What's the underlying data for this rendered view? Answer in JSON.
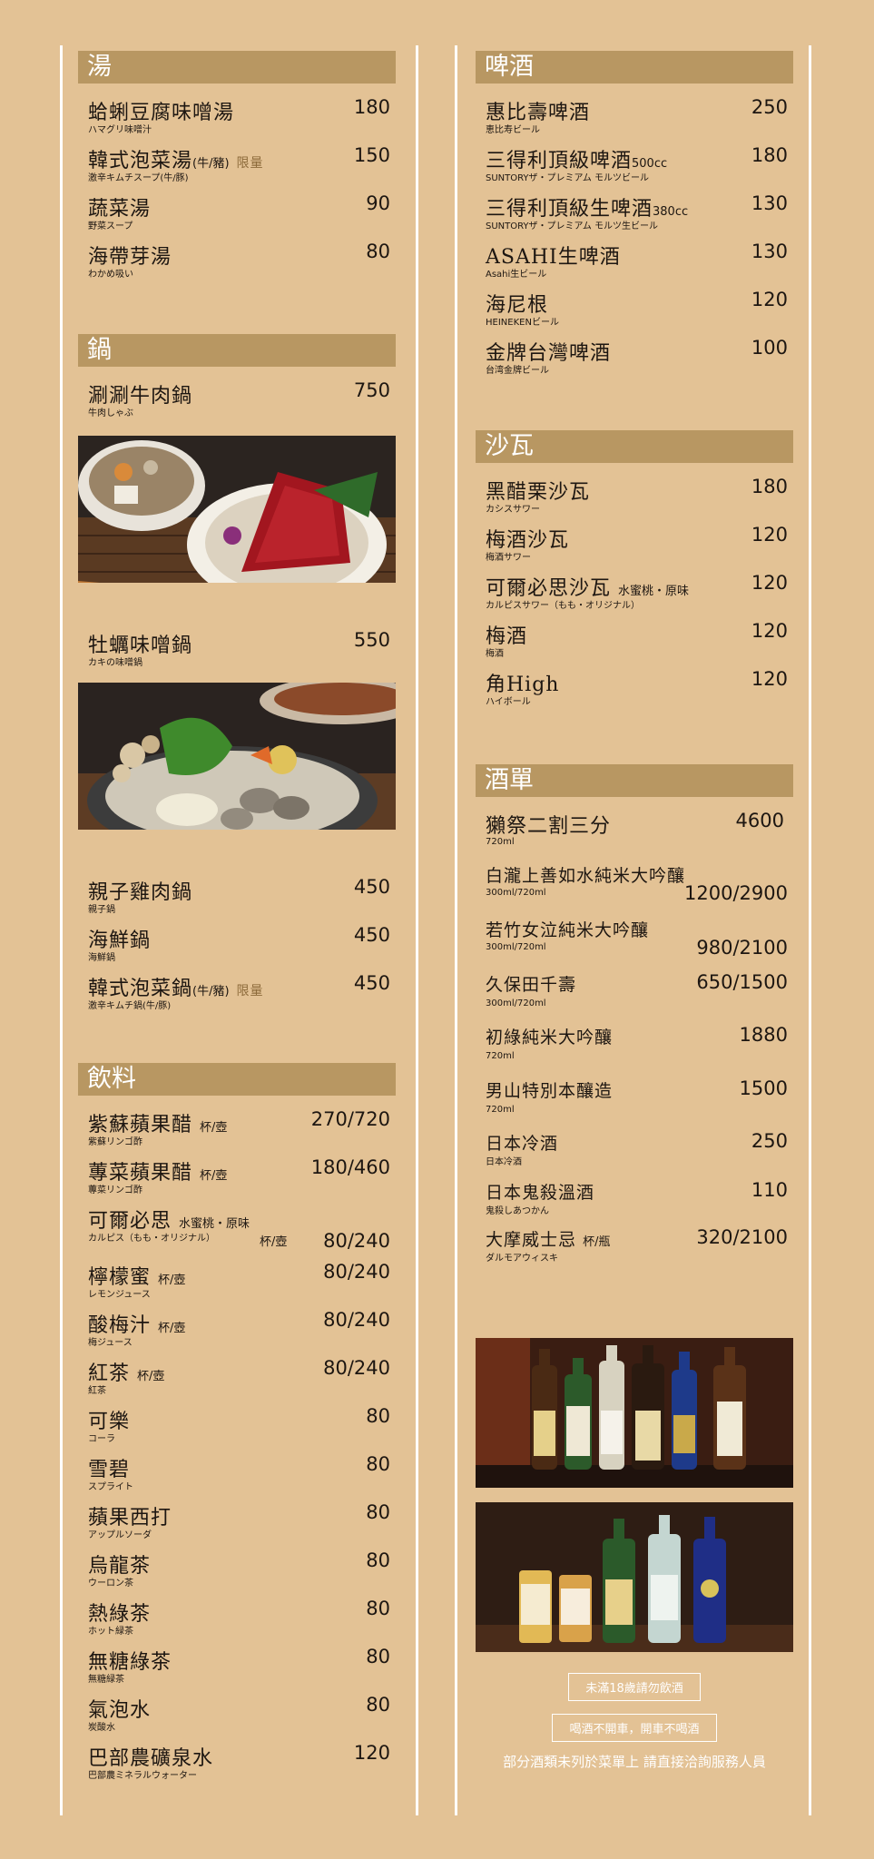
{
  "soup": {
    "title": "湯",
    "items": [
      {
        "name": "蛤蜊豆腐味噌湯",
        "sub": "ハマグリ味噌汁",
        "price": "180"
      },
      {
        "name": "韓式泡菜湯",
        "tag": "(牛/豬)",
        "note": "限量",
        "sub": "激辛キムチスープ(牛/豚)",
        "price": "150"
      },
      {
        "name": "蔬菜湯",
        "sub": "野菜スープ",
        "price": "90"
      },
      {
        "name": "海帶芽湯",
        "sub": "わかめ吸い",
        "price": "80"
      }
    ]
  },
  "pot": {
    "title": "鍋",
    "items": [
      {
        "name": "涮涮牛肉鍋",
        "sub": "牛肉しゃぶ",
        "price": "750"
      },
      {
        "name": "牡蠣味噌鍋",
        "sub": "カキの味噌鍋",
        "price": "550"
      },
      {
        "name": "親子雞肉鍋",
        "sub": "親子鍋",
        "price": "450"
      },
      {
        "name": "海鮮鍋",
        "sub": "海鮮鍋",
        "price": "450"
      },
      {
        "name": "韓式泡菜鍋",
        "tag": "(牛/豬)",
        "note": "限量",
        "sub": "激辛キムチ鍋(牛/豚)",
        "price": "450"
      }
    ]
  },
  "drinks": {
    "title": "飲料",
    "items": [
      {
        "name": "紫蘇蘋果醋",
        "tag": "杯/壺",
        "sub": "紫蘇リンゴ酢",
        "price": "270/720"
      },
      {
        "name": "蓴菜蘋果醋",
        "tag": "杯/壺",
        "sub": "蓴菜リンゴ酢",
        "price": "180/460"
      },
      {
        "name": "可爾必思",
        "tag": "水蜜桃・原味",
        "sub": "カルピス（もも・オリジナル）",
        "unit2": "杯/壺",
        "price": "80/240"
      },
      {
        "name": "檸檬蜜",
        "tag": "杯/壺",
        "sub": "レモンジュース",
        "price": "80/240"
      },
      {
        "name": "酸梅汁",
        "tag": "杯/壺",
        "sub": "梅ジュース",
        "price": "80/240"
      },
      {
        "name": "紅茶",
        "tag": "杯/壺",
        "sub": "紅茶",
        "price": "80/240"
      },
      {
        "name": "可樂",
        "sub": "コーラ",
        "price": "80"
      },
      {
        "name": "雪碧",
        "sub": "スプライト",
        "price": "80"
      },
      {
        "name": "蘋果西打",
        "sub": "アップルソーダ",
        "price": "80"
      },
      {
        "name": "烏龍茶",
        "sub": "ウーロン茶",
        "price": "80"
      },
      {
        "name": "熱綠茶",
        "sub": "ホット緑茶",
        "price": "80"
      },
      {
        "name": "無糖綠茶",
        "sub": "無糖緑茶",
        "price": "80"
      },
      {
        "name": "氣泡水",
        "sub": "炭酸水",
        "price": "80"
      },
      {
        "name": "巴部農礦泉水",
        "sub": "巴部農ミネラルウォーター",
        "price": "120"
      }
    ]
  },
  "beer": {
    "title": "啤酒",
    "items": [
      {
        "name": "惠比壽啤酒",
        "sub": "恵比寿ビール",
        "price": "250"
      },
      {
        "name": "三得利頂級啤酒",
        "tag": "500cc",
        "sub": "SUNTORYザ・プレミアム モルツビール",
        "price": "180"
      },
      {
        "name": "三得利頂級生啤酒",
        "tag": "380cc",
        "sub": "SUNTORYザ・プレミアム モルツ生ビール",
        "price": "130"
      },
      {
        "name": "ASAHI生啤酒",
        "sub": "Asahi生ビール",
        "price": "130"
      },
      {
        "name": "海尼根",
        "sub": "HEINEKENビール",
        "price": "120"
      },
      {
        "name": "金牌台灣啤酒",
        "sub": "台湾金牌ビール",
        "price": "100"
      }
    ]
  },
  "sour": {
    "title": "沙瓦",
    "items": [
      {
        "name": "黑醋栗沙瓦",
        "sub": "カシスサワー",
        "price": "180"
      },
      {
        "name": "梅酒沙瓦",
        "sub": "梅酒サワー",
        "price": "120"
      },
      {
        "name": "可爾必思沙瓦",
        "tag": "水蜜桃・原味",
        "sub": "カルピスサワー（もも・オリジナル）",
        "price": "120"
      },
      {
        "name": "梅酒",
        "sub": "梅酒",
        "price": "120"
      },
      {
        "name": "角High",
        "sub": "ハイボール",
        "price": "120"
      }
    ]
  },
  "sake": {
    "title": "酒單",
    "items": [
      {
        "name": "獺祭二割三分",
        "sub": "720ml",
        "price": "4600"
      },
      {
        "name": "白瀧上善如水純米大吟釀",
        "sub": "300ml/720ml",
        "price": "1200/2900"
      },
      {
        "name": "若竹女泣純米大吟釀",
        "sub": "300ml/720ml",
        "price": "980/2100"
      },
      {
        "name": "久保田千壽",
        "sub": "300ml/720ml",
        "price": "650/1500"
      },
      {
        "name": "初綠純米大吟釀",
        "sub": "720ml",
        "price": "1880"
      },
      {
        "name": "男山特別本釀造",
        "sub": "720ml",
        "price": "1500"
      },
      {
        "name": "日本冷酒",
        "sub": "日本冷酒",
        "price": "250"
      },
      {
        "name": "日本鬼殺溫酒",
        "sub": "鬼殺しあつかん",
        "price": "110"
      },
      {
        "name": "大摩威士忌",
        "tag": "杯/瓶",
        "sub": "ダルモアウィスキ",
        "price": "320/2100"
      }
    ]
  },
  "notices": {
    "age": "未滿18歲請勿飲酒",
    "drive": "喝酒不開車，開車不喝酒",
    "footer": "部分酒類未列於菜單上 請直接洽詢服務人員"
  }
}
